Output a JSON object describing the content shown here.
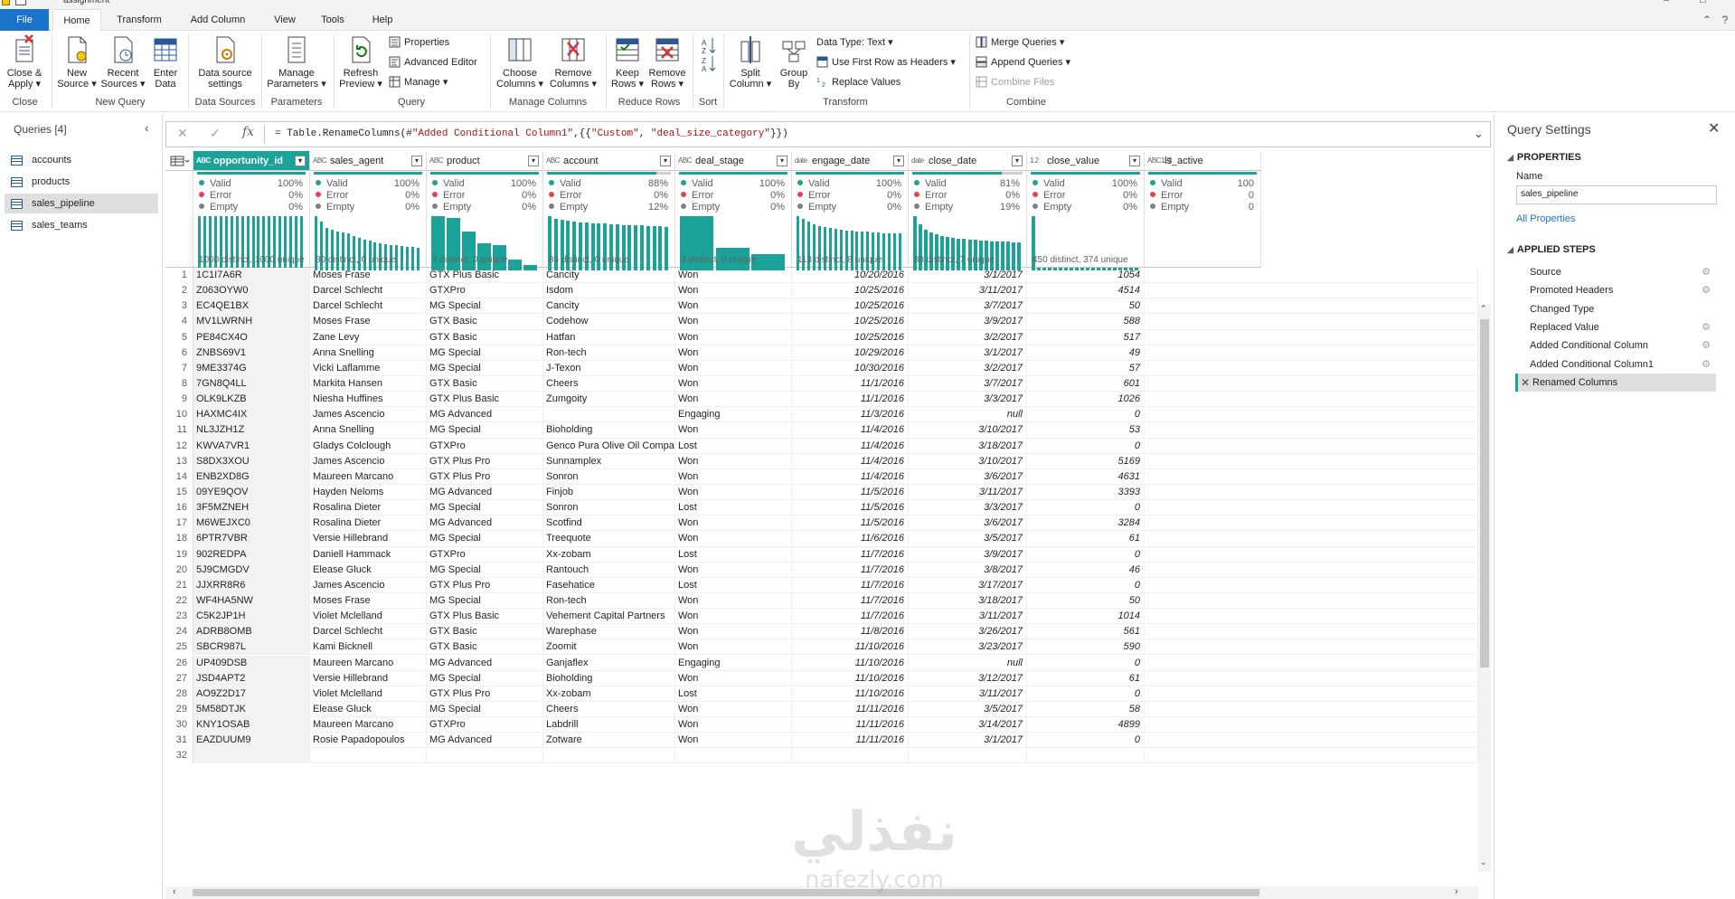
{
  "window": {
    "title": "assignment"
  },
  "tabs": [
    "File",
    "Home",
    "Transform",
    "Add Column",
    "View",
    "Tools",
    "Help"
  ],
  "ribbon": {
    "close": {
      "close_apply": "Close &",
      "close_apply2": "Apply",
      "group": "Close"
    },
    "new_query": {
      "new_source": "New",
      "new_source2": "Source",
      "recent": "Recent",
      "recent2": "Sources",
      "enter": "Enter",
      "enter2": "Data",
      "group": "New Query"
    },
    "data_sources": {
      "label": "Data source",
      "label2": "settings",
      "group": "Data Sources"
    },
    "parameters": {
      "label": "Manage",
      "label2": "Parameters",
      "group": "Parameters"
    },
    "query": {
      "refresh": "Refresh",
      "refresh2": "Preview",
      "properties": "Properties",
      "advanced": "Advanced Editor",
      "manage": "Manage",
      "group": "Query"
    },
    "manage_columns": {
      "choose": "Choose",
      "choose2": "Columns",
      "remove": "Remove",
      "remove2": "Columns",
      "group": "Manage Columns"
    },
    "reduce_rows": {
      "keep": "Keep",
      "keep2": "Rows",
      "remove": "Remove",
      "remove2": "Rows",
      "group": "Reduce Rows"
    },
    "sort": {
      "group": "Sort"
    },
    "transform": {
      "split": "Split",
      "split2": "Column",
      "group_by": "Group",
      "group_by2": "By",
      "data_type": "Data Type: Text",
      "first_row": "Use First Row as Headers",
      "replace": "Replace Values",
      "group": "Transform"
    },
    "combine": {
      "merge": "Merge Queries",
      "append": "Append Queries",
      "combine_files": "Combine Files",
      "group": "Combine"
    }
  },
  "queries": {
    "header": "Queries [4]",
    "items": [
      "accounts",
      "products",
      "sales_pipeline",
      "sales_teams"
    ],
    "selected": "sales_pipeline"
  },
  "formula": {
    "prefix": "= Table.RenameColumns(#",
    "arg1": "\"Added Conditional Column1\"",
    "mid": ",{{",
    "arg2": "\"Custom\"",
    "comma": ", ",
    "arg3": "\"deal_size_category\"",
    "suffix": "}})"
  },
  "labels": {
    "valid": "Valid",
    "error": "Error",
    "empty": "Empty"
  },
  "colors": {
    "accent": "#1ba39a",
    "valid": "#1ba39a",
    "error": "#e3454f",
    "empty": "#808080",
    "file_tab": "#1a73c9"
  },
  "columns": [
    {
      "name": "opportunity_id",
      "type": "ABC",
      "selected": true,
      "valid": "100%",
      "error": "0%",
      "empty": "0%",
      "valid_frac": 1.0,
      "footer": "1000 distinct, 1000 unique",
      "dist": [
        1,
        1,
        1,
        1,
        1,
        1,
        1,
        1,
        1,
        1,
        1,
        1,
        1,
        1,
        1,
        1,
        1,
        1,
        1,
        1
      ]
    },
    {
      "name": "sales_agent",
      "type": "ABC",
      "valid": "100%",
      "error": "0%",
      "empty": "0%",
      "valid_frac": 1.0,
      "footer": "30 distinct, 0 unique",
      "dist": [
        1.0,
        0.9,
        0.78,
        0.75,
        0.72,
        0.7,
        0.68,
        0.64,
        0.6,
        0.57,
        0.55,
        0.52,
        0.5,
        0.48,
        0.47,
        0.46,
        0.45,
        0.44,
        0.43,
        0.42
      ]
    },
    {
      "name": "product",
      "type": "ABC",
      "valid": "100%",
      "error": "0%",
      "empty": "0%",
      "valid_frac": 1.0,
      "footer": "7 distinct, 0 unique",
      "dist": [
        1.0,
        0.97,
        0.72,
        0.5,
        0.47,
        0.2,
        0.1
      ]
    },
    {
      "name": "account",
      "type": "ABC",
      "valid": "88%",
      "error": "0%",
      "empty": "12%",
      "valid_frac": 0.88,
      "footer": "86 distinct, 0 unique",
      "dist": [
        1.0,
        0.95,
        0.94,
        0.92,
        0.9,
        0.89,
        0.88,
        0.87,
        0.86,
        0.86,
        0.85,
        0.85,
        0.84,
        0.84,
        0.83,
        0.83,
        0.82,
        0.82,
        0.81,
        0.8
      ]
    },
    {
      "name": "deal_stage",
      "type": "ABC",
      "valid": "100%",
      "error": "0%",
      "empty": "0%",
      "valid_frac": 1.0,
      "footer": "3 distinct, 0 unique",
      "dist": [
        1.0,
        0.42,
        0.3
      ]
    },
    {
      "name": "engage_date",
      "type": "date",
      "valid": "100%",
      "error": "0%",
      "empty": "0%",
      "valid_frac": 1.0,
      "footer": "113 distinct, 8 unique",
      "dist": [
        1.0,
        0.95,
        0.9,
        0.85,
        0.82,
        0.8,
        0.78,
        0.76,
        0.75,
        0.74,
        0.73,
        0.72,
        0.72,
        0.71,
        0.7,
        0.7,
        0.69,
        0.69,
        0.68,
        0.68
      ]
    },
    {
      "name": "close_date",
      "type": "date",
      "valid": "81%",
      "error": "0%",
      "empty": "19%",
      "valid_frac": 0.81,
      "footer": "88 distinct, 7 unique",
      "dist": [
        1.0,
        0.85,
        0.75,
        0.7,
        0.67,
        0.64,
        0.62,
        0.6,
        0.59,
        0.58,
        0.57,
        0.56,
        0.55,
        0.55,
        0.54,
        0.54,
        0.53,
        0.53,
        0.52,
        0.52
      ]
    },
    {
      "name": "close_value",
      "type": "1.2",
      "valid": "100%",
      "error": "0%",
      "empty": "0%",
      "valid_frac": 1.0,
      "footer": "450 distinct, 374 unique",
      "dist": [
        1.0,
        0.05,
        0.05,
        0.05,
        0.05,
        0.05,
        0.05,
        0.05,
        0.05,
        0.05,
        0.05,
        0.05,
        0.05,
        0.05,
        0.05,
        0.05,
        0.05,
        0.05,
        0.05,
        0.05
      ]
    },
    {
      "name": "is_active",
      "type": "ABC123",
      "valid": "100",
      "error": "0",
      "empty": "0",
      "valid_frac": 1.0,
      "footer": "",
      "dist": []
    }
  ],
  "rows": [
    [
      "1",
      "1C1I7A6R",
      "Moses Frase",
      "GTX Plus Basic",
      "Cancity",
      "Won",
      "10/20/2016",
      "3/1/2017",
      "1054"
    ],
    [
      "2",
      "Z063OYW0",
      "Darcel Schlecht",
      "GTXPro",
      "Isdom",
      "Won",
      "10/25/2016",
      "3/11/2017",
      "4514"
    ],
    [
      "3",
      "EC4QE1BX",
      "Darcel Schlecht",
      "MG Special",
      "Cancity",
      "Won",
      "10/25/2016",
      "3/7/2017",
      "50"
    ],
    [
      "4",
      "MV1LWRNH",
      "Moses Frase",
      "GTX Basic",
      "Codehow",
      "Won",
      "10/25/2016",
      "3/9/2017",
      "588"
    ],
    [
      "5",
      "PE84CX4O",
      "Zane Levy",
      "GTX Basic",
      "Hatfan",
      "Won",
      "10/25/2016",
      "3/2/2017",
      "517"
    ],
    [
      "6",
      "ZNBS69V1",
      "Anna Snelling",
      "MG Special",
      "Ron-tech",
      "Won",
      "10/29/2016",
      "3/1/2017",
      "49"
    ],
    [
      "7",
      "9ME3374G",
      "Vicki Laflamme",
      "MG Special",
      "J-Texon",
      "Won",
      "10/30/2016",
      "3/2/2017",
      "57"
    ],
    [
      "8",
      "7GN8Q4LL",
      "Markita Hansen",
      "GTX Basic",
      "Cheers",
      "Won",
      "11/1/2016",
      "3/7/2017",
      "601"
    ],
    [
      "9",
      "OLK9LKZB",
      "Niesha Huffines",
      "GTX Plus Basic",
      "Zumgoity",
      "Won",
      "11/1/2016",
      "3/3/2017",
      "1026"
    ],
    [
      "10",
      "HAXMC4IX",
      "James Ascencio",
      "MG Advanced",
      "",
      "Engaging",
      "11/3/2016",
      "null",
      "0"
    ],
    [
      "11",
      "NL3JZH1Z",
      "Anna Snelling",
      "MG Special",
      "Bioholding",
      "Won",
      "11/4/2016",
      "3/10/2017",
      "53"
    ],
    [
      "12",
      "KWVA7VR1",
      "Gladys Colclough",
      "GTXPro",
      "Genco Pura Olive Oil Company",
      "Lost",
      "11/4/2016",
      "3/18/2017",
      "0"
    ],
    [
      "13",
      "S8DX3XOU",
      "James Ascencio",
      "GTX Plus Pro",
      "Sunnamplex",
      "Won",
      "11/4/2016",
      "3/10/2017",
      "5169"
    ],
    [
      "14",
      "ENB2XD8G",
      "Maureen Marcano",
      "GTX Plus Pro",
      "Sonron",
      "Won",
      "11/4/2016",
      "3/6/2017",
      "4631"
    ],
    [
      "15",
      "09YE9QOV",
      "Hayden Neloms",
      "MG Advanced",
      "Finjob",
      "Won",
      "11/5/2016",
      "3/11/2017",
      "3393"
    ],
    [
      "16",
      "3F5MZNEH",
      "Rosalina Dieter",
      "MG Special",
      "Sonron",
      "Lost",
      "11/5/2016",
      "3/3/2017",
      "0"
    ],
    [
      "17",
      "M6WEJXC0",
      "Rosalina Dieter",
      "MG Advanced",
      "Scotfind",
      "Won",
      "11/5/2016",
      "3/6/2017",
      "3284"
    ],
    [
      "18",
      "6PTR7VBR",
      "Versie Hillebrand",
      "MG Special",
      "Treequote",
      "Won",
      "11/6/2016",
      "3/5/2017",
      "61"
    ],
    [
      "19",
      "902REDPA",
      "Daniell Hammack",
      "GTXPro",
      "Xx-zobam",
      "Lost",
      "11/7/2016",
      "3/9/2017",
      "0"
    ],
    [
      "20",
      "5J9CMGDV",
      "Elease Gluck",
      "MG Special",
      "Rantouch",
      "Won",
      "11/7/2016",
      "3/8/2017",
      "46"
    ],
    [
      "21",
      "JJXRR8R6",
      "James Ascencio",
      "GTX Plus Pro",
      "Fasehatice",
      "Lost",
      "11/7/2016",
      "3/17/2017",
      "0"
    ],
    [
      "22",
      "WF4HA5NW",
      "Moses Frase",
      "MG Special",
      "Ron-tech",
      "Won",
      "11/7/2016",
      "3/18/2017",
      "50"
    ],
    [
      "23",
      "C5K2JP1H",
      "Violet Mclelland",
      "GTX Plus Basic",
      "Vehement Capital Partners",
      "Won",
      "11/7/2016",
      "3/11/2017",
      "1014"
    ],
    [
      "24",
      "ADRB8OMB",
      "Darcel Schlecht",
      "GTX Basic",
      "Warephase",
      "Won",
      "11/8/2016",
      "3/26/2017",
      "561"
    ],
    [
      "25",
      "SBCR987L",
      "Kami Bicknell",
      "GTX Basic",
      "Zoomit",
      "Won",
      "11/10/2016",
      "3/23/2017",
      "590"
    ],
    [
      "26",
      "UP409DSB",
      "Maureen Marcano",
      "MG Advanced",
      "Ganjaflex",
      "Engaging",
      "11/10/2016",
      "null",
      "0"
    ],
    [
      "27",
      "JSD4APT2",
      "Versie Hillebrand",
      "MG Special",
      "Bioholding",
      "Won",
      "11/10/2016",
      "3/12/2017",
      "61"
    ],
    [
      "28",
      "AO9Z2D17",
      "Violet Mclelland",
      "GTX Plus Pro",
      "Xx-zobam",
      "Lost",
      "11/10/2016",
      "3/11/2017",
      "0"
    ],
    [
      "29",
      "5M58DTJK",
      "Elease Gluck",
      "MG Special",
      "Cheers",
      "Won",
      "11/11/2016",
      "3/5/2017",
      "58"
    ],
    [
      "30",
      "KNY1OSAB",
      "Maureen Marcano",
      "GTXPro",
      "Labdrill",
      "Won",
      "11/11/2016",
      "3/14/2017",
      "4899"
    ],
    [
      "31",
      "EAZDUUM9",
      "Rosie Papadopoulos",
      "MG Advanced",
      "Zotware",
      "Won",
      "11/11/2016",
      "3/1/2017",
      "0"
    ],
    [
      "32",
      "",
      "",
      "",
      "",
      "",
      "",
      "",
      ""
    ]
  ],
  "settings": {
    "title": "Query Settings",
    "properties_header": "PROPERTIES",
    "name_label": "Name",
    "name_value": "sales_pipeline",
    "all_properties": "All Properties",
    "steps_header": "APPLIED STEPS",
    "steps": [
      {
        "label": "Source",
        "gear": true
      },
      {
        "label": "Promoted Headers",
        "gear": true
      },
      {
        "label": "Changed Type",
        "gear": false
      },
      {
        "label": "Replaced Value",
        "gear": true
      },
      {
        "label": "Added Conditional Column",
        "gear": true
      },
      {
        "label": "Added Conditional Column1",
        "gear": true
      },
      {
        "label": "Renamed Columns",
        "gear": false
      }
    ]
  },
  "watermark": {
    "arabic": "نفذلي",
    "latin": "nafezly.com"
  }
}
